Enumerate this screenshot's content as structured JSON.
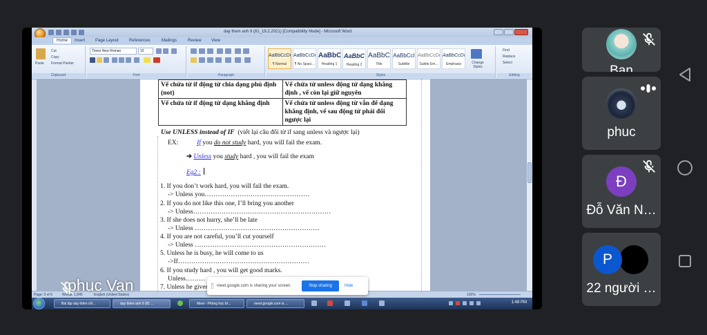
{
  "word": {
    "title": "day them anh 9 (81_19.2.2021) [Compatibility Mode] - Microsoft Word",
    "tabs": [
      "Home",
      "Insert",
      "Page Layout",
      "References",
      "Mailings",
      "Review",
      "View"
    ],
    "clipboard": {
      "paste": "Paste",
      "cut": "Cut",
      "copy": "Copy",
      "format_painter": "Format Painter",
      "label": "Clipboard"
    },
    "font": {
      "name": "Times New Roman",
      "size": "15",
      "label": "Font"
    },
    "paragraph_label": "Paragraph",
    "styles": [
      {
        "preview": "AaBbCcDc",
        "name": "¶ Normal"
      },
      {
        "preview": "AaBbCcDc",
        "name": "¶ No Spaci..."
      },
      {
        "preview": "AaBbC",
        "name": "Heading 1"
      },
      {
        "preview": "AaBbC",
        "name": "Heading 2"
      },
      {
        "preview": "AaBbC",
        "name": "Title"
      },
      {
        "preview": "AaBbCcI",
        "name": "Subtitle"
      },
      {
        "preview": "AaBbCcDc",
        "name": "Subtle Em..."
      },
      {
        "preview": "AaBbCcDc",
        "name": "Emphasis"
      }
    ],
    "styles_label": "Styles",
    "change_styles": "Change Styles",
    "editing": {
      "find": "Find",
      "replace": "Replace",
      "select": "Select",
      "label": "Editing"
    },
    "table": [
      [
        "Vế chứa từ if động từ chia dạng phủ định (not)",
        "Vế chứa từ unless động từ dạng khẳng định , vế còn lại giữ nguyên"
      ],
      [
        "Vế chứa từ if động từ dạng khẳng định",
        "Vế chứa từ unless động từ vẫn để dạng khẳng định, vế sau động từ phải đổi ngược lại"
      ]
    ],
    "heading_bold": "Use UNLESS instead of IF",
    "heading_note": "(viết lại câu đổi từ if sang unless và ngược lại)",
    "ex_label": "EX:",
    "ex_if": "If",
    "ex_you": " you ",
    "ex_do_not_study": "do not study",
    "ex_rest": " hard, you will fail the exam.",
    "ex2_arrow": "➔ ",
    "ex2_unless": "Unless",
    "ex2_you": " you ",
    "ex2_study": "study",
    "ex2_rest": " hard , you will fail the exam",
    "eg2": "Eg2 :",
    "exercises": [
      {
        "q": "1.  If you don’t work hard, you will fail the exam.",
        "a": "->  Unless you…………………………………………"
      },
      {
        "q": "2.  If you do not like this one, I’ll bring you another",
        "a": "-> Unless………………………………………………………"
      },
      {
        "q": "3.  If she does not hurry, she’ll be late",
        "a": "-> Unless …………………………………………………"
      },
      {
        "q": "4.  If you are not careful, you’ll cut yourself",
        "a": "-> Unless ……………………………………………………"
      },
      {
        "q": "5.  Unless he is busy, he will come to us",
        "a": "->If……………………………………………………"
      },
      {
        "q": "6.  If you study hard , you will get good marks.",
        "a": "Unless………"
      },
      {
        "q": "7.  Unless he gives u…",
        "a": ""
      }
    ],
    "status": {
      "page": "Page: 5 of 6",
      "words": "Words: 1,845",
      "lang": "English (United States)",
      "zoom": "100%"
    },
    "taskbar": [
      "Bài tập day thêm chỉ...",
      "day them anh 9 (81 ...",
      "Meet - Phòng học lớ...",
      "meet.google.com is ..."
    ],
    "clock": "1:48 PM"
  },
  "share_bar": {
    "message": "meet.google.com is sharing your screen.",
    "stop": "Stop sharing",
    "hide": "Hide"
  },
  "presenter": {
    "name": "phuc Van"
  },
  "participants": [
    {
      "name": "Bạn"
    },
    {
      "name": "phuc"
    },
    {
      "name": "Đỗ Văn N…",
      "initial": "Đ",
      "color": "#7b3fc0"
    },
    {
      "name": "22 người …",
      "initial": "P",
      "color": "#0b57d0"
    }
  ]
}
